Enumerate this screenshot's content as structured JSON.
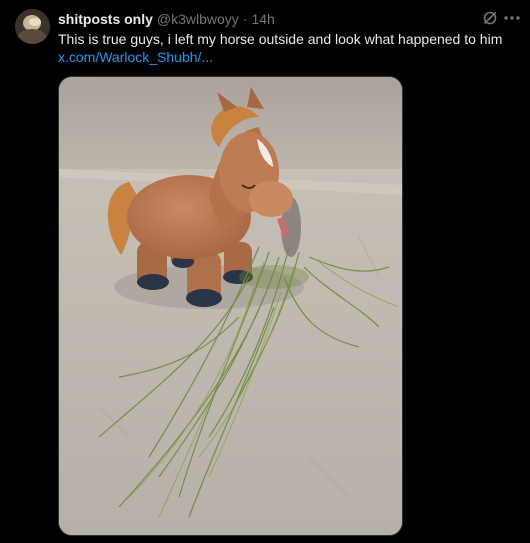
{
  "tweet": {
    "display_name": "shitposts only",
    "handle": "@k3wlbwoyy",
    "separator": "·",
    "time": "14h",
    "text": "This is true guys, i left my horse outside and look what happened to him",
    "link": "x.com/Warlock_Shubh/...",
    "icons": {
      "avatar": "avatar-image",
      "grok": "grok-icon",
      "more": "more-options-icon"
    },
    "colors": {
      "background": "#000000",
      "text": "#e7e9ea",
      "secondary": "#71767b",
      "link": "#1d9bf0"
    }
  }
}
